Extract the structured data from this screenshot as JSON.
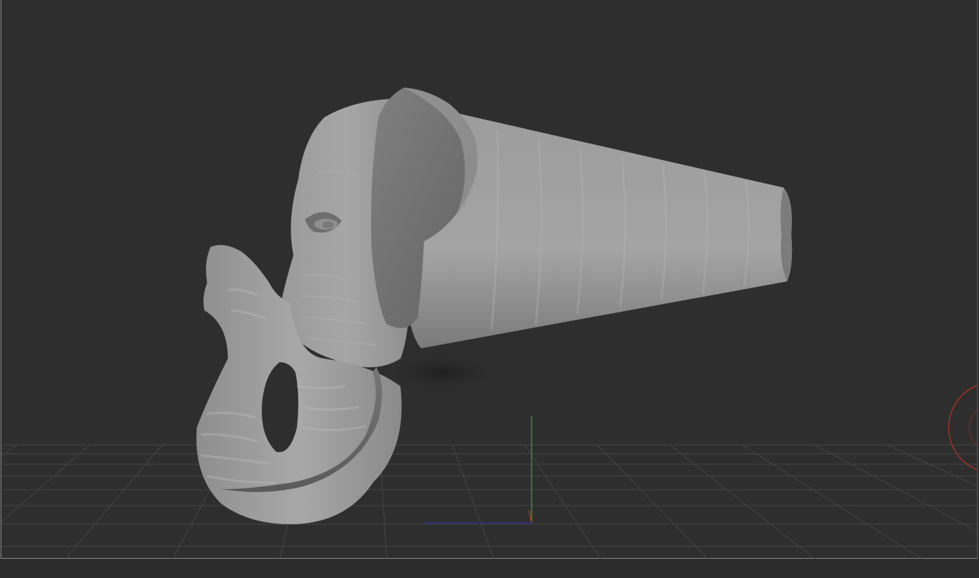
{
  "app": {
    "view": "perspective-viewport",
    "background_color": "#2e2e2e",
    "grid_color": "#474747",
    "axis_colors": {
      "y": "#2fb52f",
      "x": "#2a2a9a",
      "z": "#c0321e"
    }
  },
  "scene": {
    "object": "elephant-head-sculpt",
    "object_color": "#8c8c8c",
    "grid": "on",
    "gizmo": "rotate-circle-partial"
  }
}
